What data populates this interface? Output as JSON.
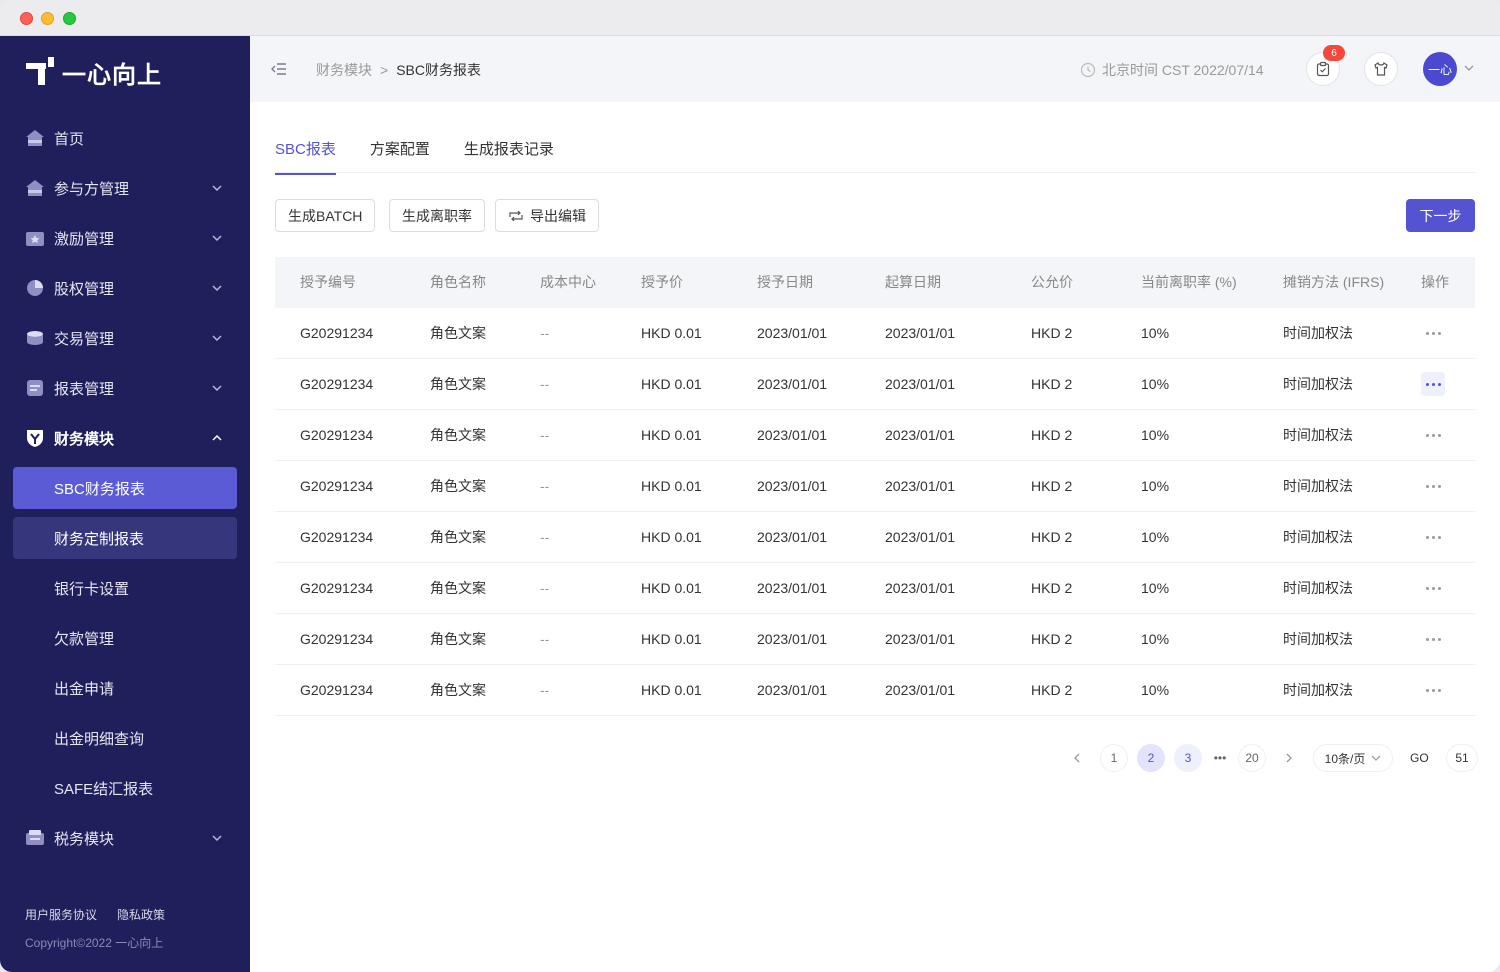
{
  "brand": {
    "name": "一心向上"
  },
  "sidebar": {
    "items": [
      {
        "label": "首页",
        "icon": "home-icon",
        "expandable": false
      },
      {
        "label": "参与方管理",
        "icon": "participant-icon",
        "expandable": true
      },
      {
        "label": "激励管理",
        "icon": "incentive-icon",
        "expandable": true
      },
      {
        "label": "股权管理",
        "icon": "equity-icon",
        "expandable": true
      },
      {
        "label": "交易管理",
        "icon": "trade-icon",
        "expandable": true
      },
      {
        "label": "报表管理",
        "icon": "report-icon",
        "expandable": true
      },
      {
        "label": "财务模块",
        "icon": "finance-icon",
        "expandable": true,
        "expanded": true
      },
      {
        "label": "税务模块",
        "icon": "tax-icon",
        "expandable": true
      }
    ],
    "finance_children": [
      {
        "label": "SBC财务报表",
        "selected": true
      },
      {
        "label": "财务定制报表",
        "hovered": true
      },
      {
        "label": "银行卡设置"
      },
      {
        "label": "欠款管理"
      },
      {
        "label": "出金申请"
      },
      {
        "label": "出金明细查询"
      },
      {
        "label": "SAFE结汇报表"
      }
    ],
    "footer": {
      "terms": "用户服务协议",
      "privacy": "隐私政策",
      "copyright": "Copyright©2022 一心向上"
    }
  },
  "header": {
    "breadcrumb_parent": "财务模块",
    "breadcrumb_sep": ">",
    "breadcrumb_current": "SBC财务报表",
    "time_text": "北京时间 CST 2022/07/14",
    "notification_count": "6",
    "avatar_text": "一心"
  },
  "tabs": [
    {
      "label": "SBC报表",
      "active": true
    },
    {
      "label": "方案配置"
    },
    {
      "label": "生成报表记录"
    }
  ],
  "toolbar": {
    "batch_label": "生成BATCH",
    "turnover_label": "生成离职率",
    "export_label": "导出编辑",
    "next_label": "下一步"
  },
  "table": {
    "columns": [
      "授予编号",
      "角色名称",
      "成本中心",
      "授予价",
      "授予日期",
      "起算日期",
      "公允价",
      "当前离职率 (%)",
      "摊销方法 (IFRS)",
      "操作"
    ],
    "rows": [
      [
        "G20291234",
        "角色文案",
        "--",
        "HKD 0.01",
        "2023/01/01",
        "2023/01/01",
        "HKD 2",
        "10%",
        "时间加权法"
      ],
      [
        "G20291234",
        "角色文案",
        "--",
        "HKD 0.01",
        "2023/01/01",
        "2023/01/01",
        "HKD 2",
        "10%",
        "时间加权法"
      ],
      [
        "G20291234",
        "角色文案",
        "--",
        "HKD 0.01",
        "2023/01/01",
        "2023/01/01",
        "HKD 2",
        "10%",
        "时间加权法"
      ],
      [
        "G20291234",
        "角色文案",
        "--",
        "HKD 0.01",
        "2023/01/01",
        "2023/01/01",
        "HKD 2",
        "10%",
        "时间加权法"
      ],
      [
        "G20291234",
        "角色文案",
        "--",
        "HKD 0.01",
        "2023/01/01",
        "2023/01/01",
        "HKD 2",
        "10%",
        "时间加权法"
      ],
      [
        "G20291234",
        "角色文案",
        "--",
        "HKD 0.01",
        "2023/01/01",
        "2023/01/01",
        "HKD 2",
        "10%",
        "时间加权法"
      ],
      [
        "G20291234",
        "角色文案",
        "--",
        "HKD 0.01",
        "2023/01/01",
        "2023/01/01",
        "HKD 2",
        "10%",
        "时间加权法"
      ],
      [
        "G20291234",
        "角色文案",
        "--",
        "HKD 0.01",
        "2023/01/01",
        "2023/01/01",
        "HKD 2",
        "10%",
        "时间加权法"
      ]
    ]
  },
  "pagination": {
    "pages": [
      "1",
      "2",
      "3"
    ],
    "ellipsis": "•••",
    "last": "20",
    "current": "2",
    "per_page": "10条/页",
    "go_label": "GO",
    "go_value": "51"
  },
  "colors": {
    "accent": "#5453d2",
    "sidebar_bg": "#1f1f5c",
    "badge": "#f5473c"
  }
}
